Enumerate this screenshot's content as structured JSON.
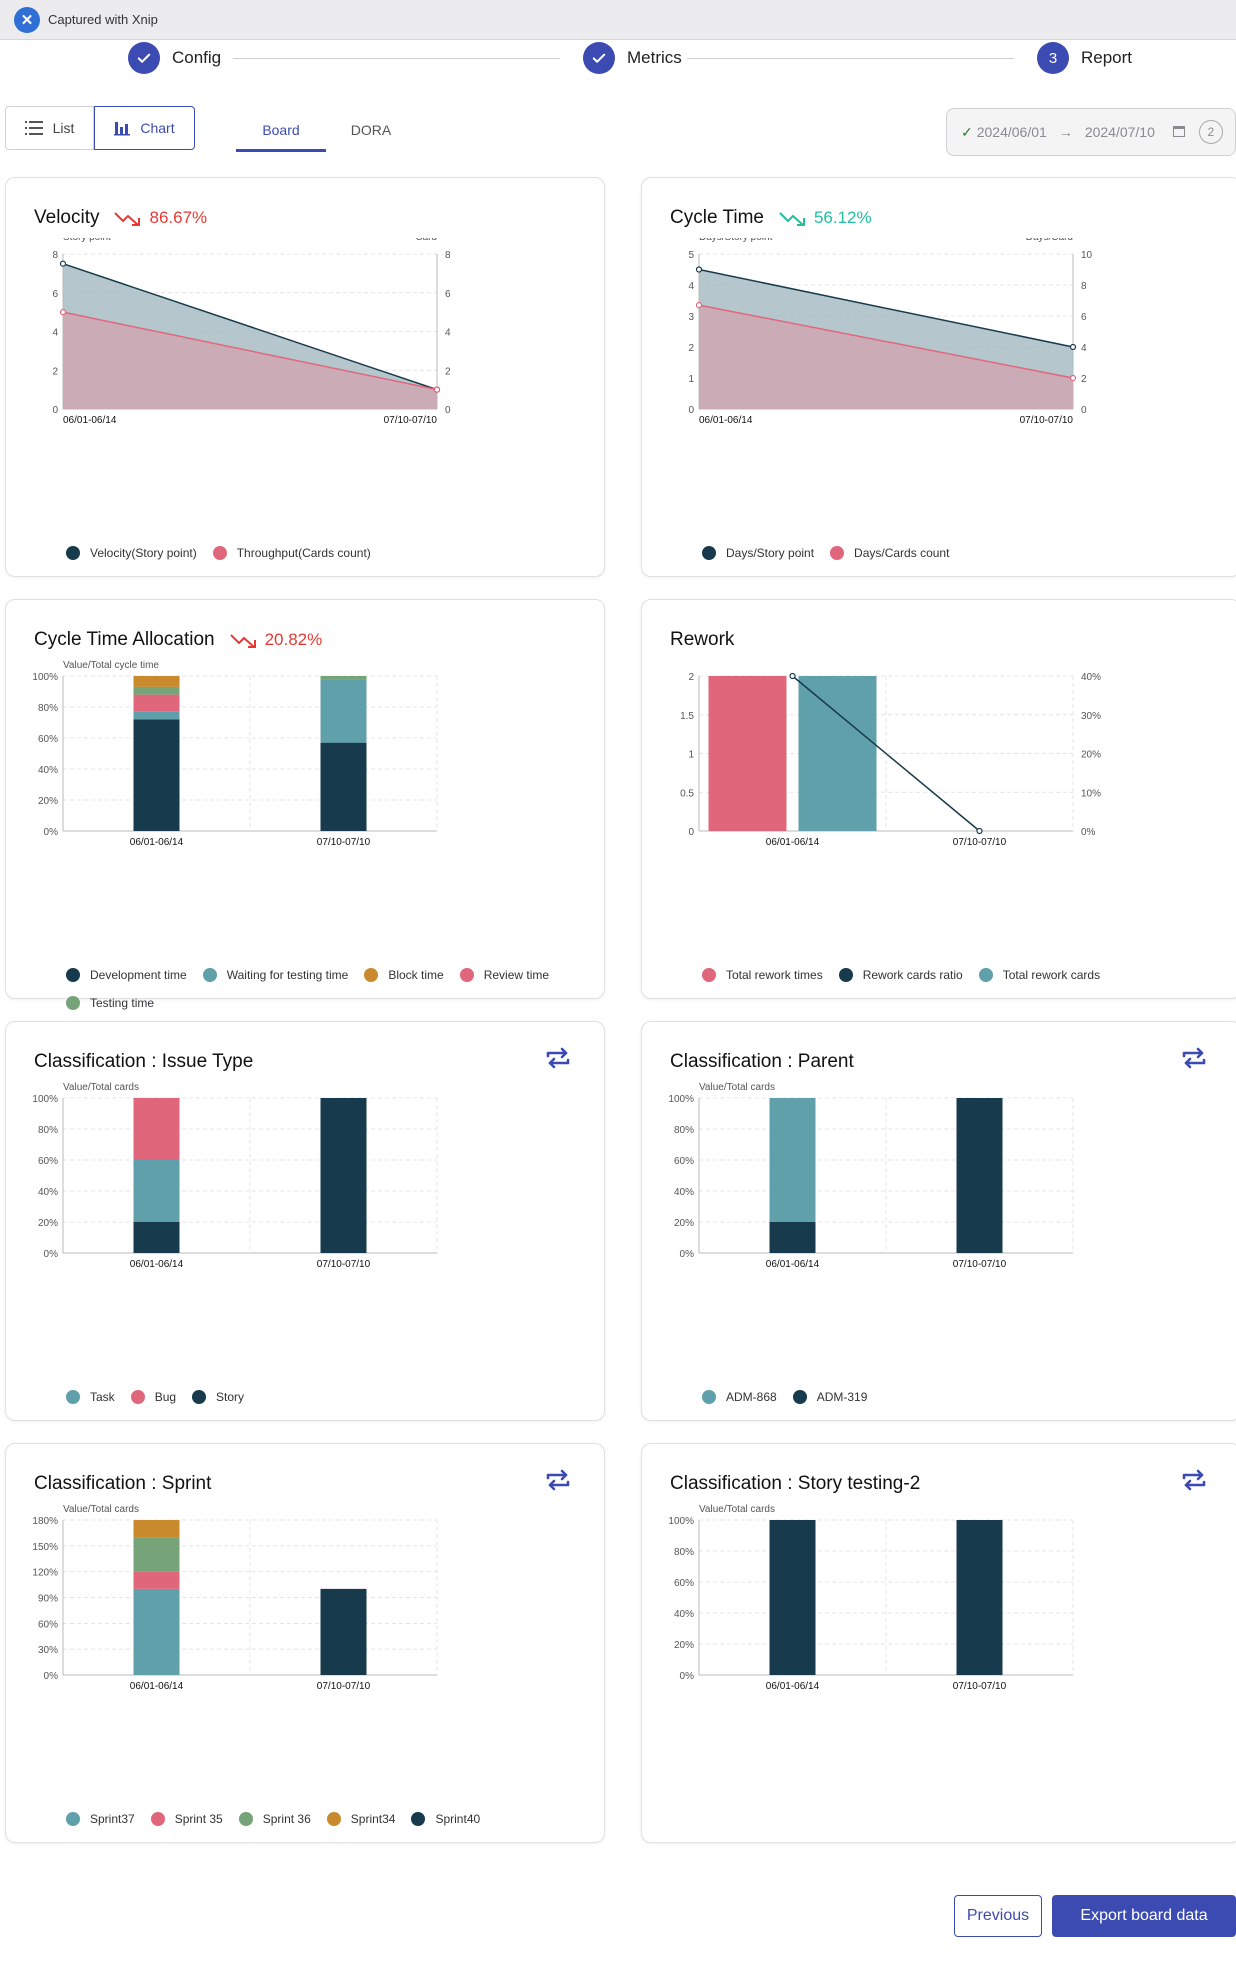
{
  "capture_bar": {
    "text": "Captured with Xnip"
  },
  "stepper": [
    {
      "label": "Config",
      "state": "done"
    },
    {
      "label": "Metrics",
      "state": "done"
    },
    {
      "label": "Report",
      "state": "active",
      "number": "3"
    }
  ],
  "view_toggle": {
    "list": "List",
    "chart": "Chart",
    "selected": "Chart"
  },
  "tabs": {
    "board": "Board",
    "dora": "DORA",
    "selected": "Board"
  },
  "date_range": {
    "start": "2024/06/01",
    "end": "2024/07/10",
    "count": "2"
  },
  "colors": {
    "dark": "#173a4c",
    "teal": "#60a0aa",
    "pink": "#e0677b",
    "orange": "#c98a2e",
    "green": "#76a377",
    "accent": "#3c4bb1",
    "down_red": "#e53935",
    "down_green": "#1fbf9f"
  },
  "cards": {
    "velocity": {
      "title": "Velocity",
      "trend": "86.67%"
    },
    "cycle_time": {
      "title": "Cycle Time",
      "trend": "56.12%"
    },
    "cycle_time_allocation": {
      "title": "Cycle Time Allocation",
      "trend": "20.82%"
    },
    "rework": {
      "title": "Rework"
    },
    "issue_type": {
      "title": "Classification : Issue Type"
    },
    "parent": {
      "title": "Classification : Parent"
    },
    "sprint": {
      "title": "Classification : Sprint"
    },
    "story_testing": {
      "title": "Classification : Story testing-2"
    }
  },
  "buttons": {
    "previous": "Previous",
    "export": "Export board data"
  },
  "chart_data": [
    {
      "id": "velocity",
      "type": "area",
      "categories": [
        "06/01-06/14",
        "07/10-07/10"
      ],
      "ylabel_left": "Story point",
      "ylabel_right": "Card",
      "yticks_left": [
        "0",
        "2",
        "4",
        "6",
        "8"
      ],
      "yticks_right": [
        "0",
        "2",
        "4",
        "6",
        "8"
      ],
      "ylim_left": [
        0,
        8
      ],
      "ylim_right": [
        0,
        8
      ],
      "series": [
        {
          "name": "Velocity(Story point)",
          "axis": "left",
          "values": [
            7.5,
            1
          ],
          "color": "#173a4c",
          "fill": "#a8bcc4"
        },
        {
          "name": "Throughput(Cards count)",
          "axis": "right",
          "values": [
            5,
            1
          ],
          "color": "#e0677b",
          "fill": "#d1a4b0"
        }
      ]
    },
    {
      "id": "cycle_time",
      "type": "area",
      "categories": [
        "06/01-06/14",
        "07/10-07/10"
      ],
      "ylabel_left": "Days/Story point",
      "ylabel_right": "Days/Card",
      "yticks_left": [
        "0",
        "1",
        "2",
        "3",
        "4",
        "5"
      ],
      "yticks_right": [
        "0",
        "2",
        "4",
        "6",
        "8",
        "10"
      ],
      "ylim_left": [
        0,
        5
      ],
      "ylim_right": [
        0,
        10
      ],
      "series": [
        {
          "name": "Days/Story point",
          "axis": "left",
          "values": [
            4.5,
            2
          ],
          "color": "#173a4c",
          "fill": "#a8bcc4"
        },
        {
          "name": "Days/Cards count",
          "axis": "right",
          "values": [
            6.7,
            2
          ],
          "color": "#e0677b",
          "fill": "#d1a4b0"
        }
      ]
    },
    {
      "id": "cycle_time_allocation",
      "type": "bar",
      "stacked": true,
      "categories": [
        "06/01-06/14",
        "07/10-07/10"
      ],
      "ylabel": "Value/Total cycle time",
      "yticks": [
        "0%",
        "20%",
        "40%",
        "60%",
        "80%",
        "100%"
      ],
      "ylim": [
        0,
        100
      ],
      "series": [
        {
          "name": "Development time",
          "values": [
            72,
            57
          ],
          "color": "#173a4c"
        },
        {
          "name": "Waiting for testing time",
          "values": [
            5,
            41
          ],
          "color": "#60a0aa"
        },
        {
          "name": "Block time",
          "values": [
            0,
            0
          ],
          "color": "#c98a2e"
        },
        {
          "name": "Review time",
          "values": [
            11,
            0
          ],
          "color": "#e0677b"
        },
        {
          "name": "Testing time",
          "values": [
            5,
            2
          ],
          "color": "#76a377"
        },
        {
          "name": "",
          "values": [
            7,
            0
          ],
          "color": "#c98a2e",
          "legend": false
        }
      ]
    },
    {
      "id": "rework",
      "type": "bar",
      "categories": [
        "06/01-06/14",
        "07/10-07/10"
      ],
      "yticks_left": [
        "0",
        "0.5",
        "1",
        "1.5",
        "2"
      ],
      "yticks_right": [
        "0%",
        "10%",
        "20%",
        "30%",
        "40%"
      ],
      "ylim_left": [
        0,
        2
      ],
      "ylim_right": [
        0,
        40
      ],
      "series": [
        {
          "name": "Total rework times",
          "type": "bar",
          "values": [
            2,
            0
          ],
          "color": "#e0677b"
        },
        {
          "name": "Rework cards ratio",
          "type": "line",
          "axis": "right",
          "values": [
            40,
            0
          ],
          "color": "#173a4c"
        },
        {
          "name": "Total rework cards",
          "type": "bar",
          "values": [
            2,
            0
          ],
          "color": "#60a0aa"
        }
      ]
    },
    {
      "id": "issue_type",
      "type": "bar",
      "stacked": true,
      "categories": [
        "06/01-06/14",
        "07/10-07/10"
      ],
      "ylabel": "Value/Total cards",
      "yticks": [
        "0%",
        "20%",
        "40%",
        "60%",
        "80%",
        "100%"
      ],
      "ylim": [
        0,
        100
      ],
      "series": [
        {
          "name": "Story",
          "values": [
            20,
            100
          ],
          "color": "#173a4c"
        },
        {
          "name": "Task",
          "values": [
            40,
            0
          ],
          "color": "#60a0aa"
        },
        {
          "name": "Bug",
          "values": [
            40,
            0
          ],
          "color": "#e0677b"
        }
      ],
      "legend_order": [
        "Task",
        "Bug",
        "Story"
      ]
    },
    {
      "id": "parent",
      "type": "bar",
      "stacked": true,
      "categories": [
        "06/01-06/14",
        "07/10-07/10"
      ],
      "ylabel": "Value/Total cards",
      "yticks": [
        "0%",
        "20%",
        "40%",
        "60%",
        "80%",
        "100%"
      ],
      "ylim": [
        0,
        100
      ],
      "series": [
        {
          "name": "ADM-319",
          "values": [
            20,
            100
          ],
          "color": "#173a4c"
        },
        {
          "name": "ADM-868",
          "values": [
            80,
            0
          ],
          "color": "#60a0aa"
        }
      ],
      "legend_order": [
        "ADM-868",
        "ADM-319"
      ]
    },
    {
      "id": "sprint",
      "type": "bar",
      "stacked": true,
      "categories": [
        "06/01-06/14",
        "07/10-07/10"
      ],
      "ylabel": "Value/Total cards",
      "yticks": [
        "0%",
        "30%",
        "60%",
        "90%",
        "120%",
        "150%",
        "180%"
      ],
      "ylim": [
        0,
        180
      ],
      "series": [
        {
          "name": "Sprint40",
          "values": [
            0,
            100
          ],
          "color": "#173a4c"
        },
        {
          "name": "Sprint37",
          "values": [
            100,
            0
          ],
          "color": "#60a0aa"
        },
        {
          "name": "Sprint 35",
          "values": [
            20,
            0
          ],
          "color": "#e0677b"
        },
        {
          "name": "Sprint 36",
          "values": [
            40,
            0
          ],
          "color": "#76a377"
        },
        {
          "name": "Sprint34",
          "values": [
            20,
            0
          ],
          "color": "#c98a2e"
        }
      ],
      "legend_order": [
        "Sprint37",
        "Sprint 35",
        "Sprint 36",
        "Sprint34",
        "Sprint40"
      ]
    },
    {
      "id": "story_testing",
      "type": "bar",
      "stacked": true,
      "categories": [
        "06/01-06/14",
        "07/10-07/10"
      ],
      "ylabel": "Value/Total cards",
      "yticks": [
        "0%",
        "20%",
        "40%",
        "60%",
        "80%",
        "100%"
      ],
      "ylim": [
        0,
        100
      ],
      "series": [
        {
          "name": "",
          "values": [
            100,
            100
          ],
          "color": "#173a4c",
          "legend": false
        }
      ],
      "legend_order": []
    }
  ]
}
